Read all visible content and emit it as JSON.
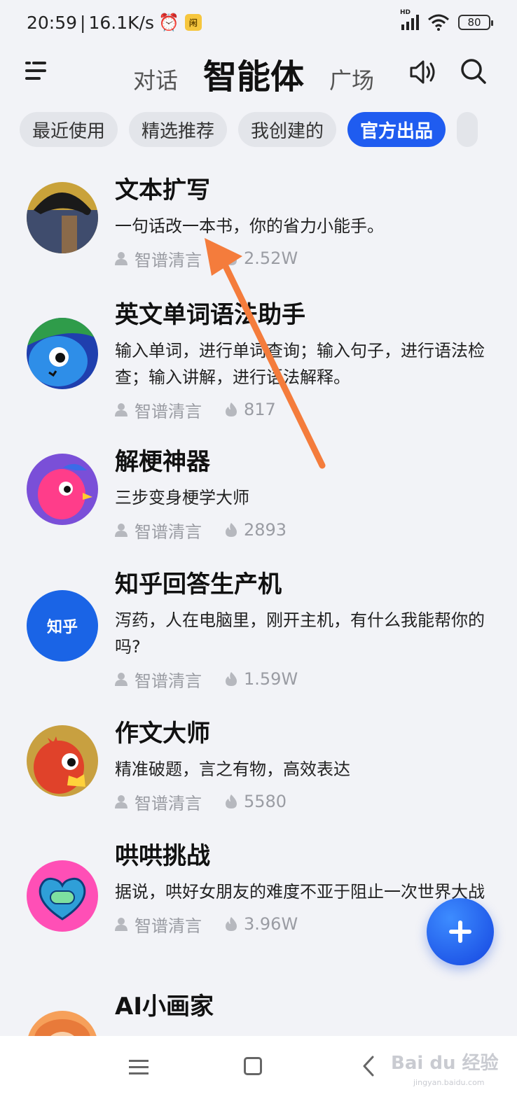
{
  "status_bar": {
    "time": "20:59",
    "net_speed": "16.1K/s",
    "signal_label": "HD",
    "battery": "80"
  },
  "header": {
    "tab_chat": "对话",
    "tab_agents": "智能体",
    "tab_plaza": "广场"
  },
  "chips": [
    "最近使用",
    "精选推荐",
    "我创建的",
    "官方出品"
  ],
  "active_chip": "官方出品",
  "agents": [
    {
      "title": "文本扩写",
      "desc": "一句话改一本书，你的省力小能手。",
      "author": "智谱清言",
      "hot": "2.52W"
    },
    {
      "title": "英文单词语法助手",
      "desc": "输入单词，进行单词查询；输入句子，进行语法检查；输入讲解，进行语法解释。",
      "author": "智谱清言",
      "hot": "817"
    },
    {
      "title": "解梗神器",
      "desc": "三步变身梗学大师",
      "author": "智谱清言",
      "hot": "2893"
    },
    {
      "title": "知乎回答生产机",
      "desc": "泻药，人在电脑里，刚开主机，有什么我能帮你的吗?",
      "author": "智谱清言",
      "hot": "1.59W"
    },
    {
      "title": "作文大师",
      "desc": "精准破题，言之有物，高效表达",
      "author": "智谱清言",
      "hot": "5580"
    },
    {
      "title": "哄哄挑战",
      "desc": "据说，哄好女朋友的难度不亚于阻止一次世界大战",
      "author": "智谱清言",
      "hot": "3.96W"
    },
    {
      "title": "AI小画家",
      "desc": "",
      "author": "",
      "hot": ""
    }
  ],
  "zhihu_logo_text": "知乎",
  "watermark": "Bai du 经验",
  "watermark_sub": "jingyan.baidu.com",
  "colors": {
    "accent": "#1f5cf0",
    "background": "#f2f3f7",
    "arrow": "#f47c3c"
  }
}
